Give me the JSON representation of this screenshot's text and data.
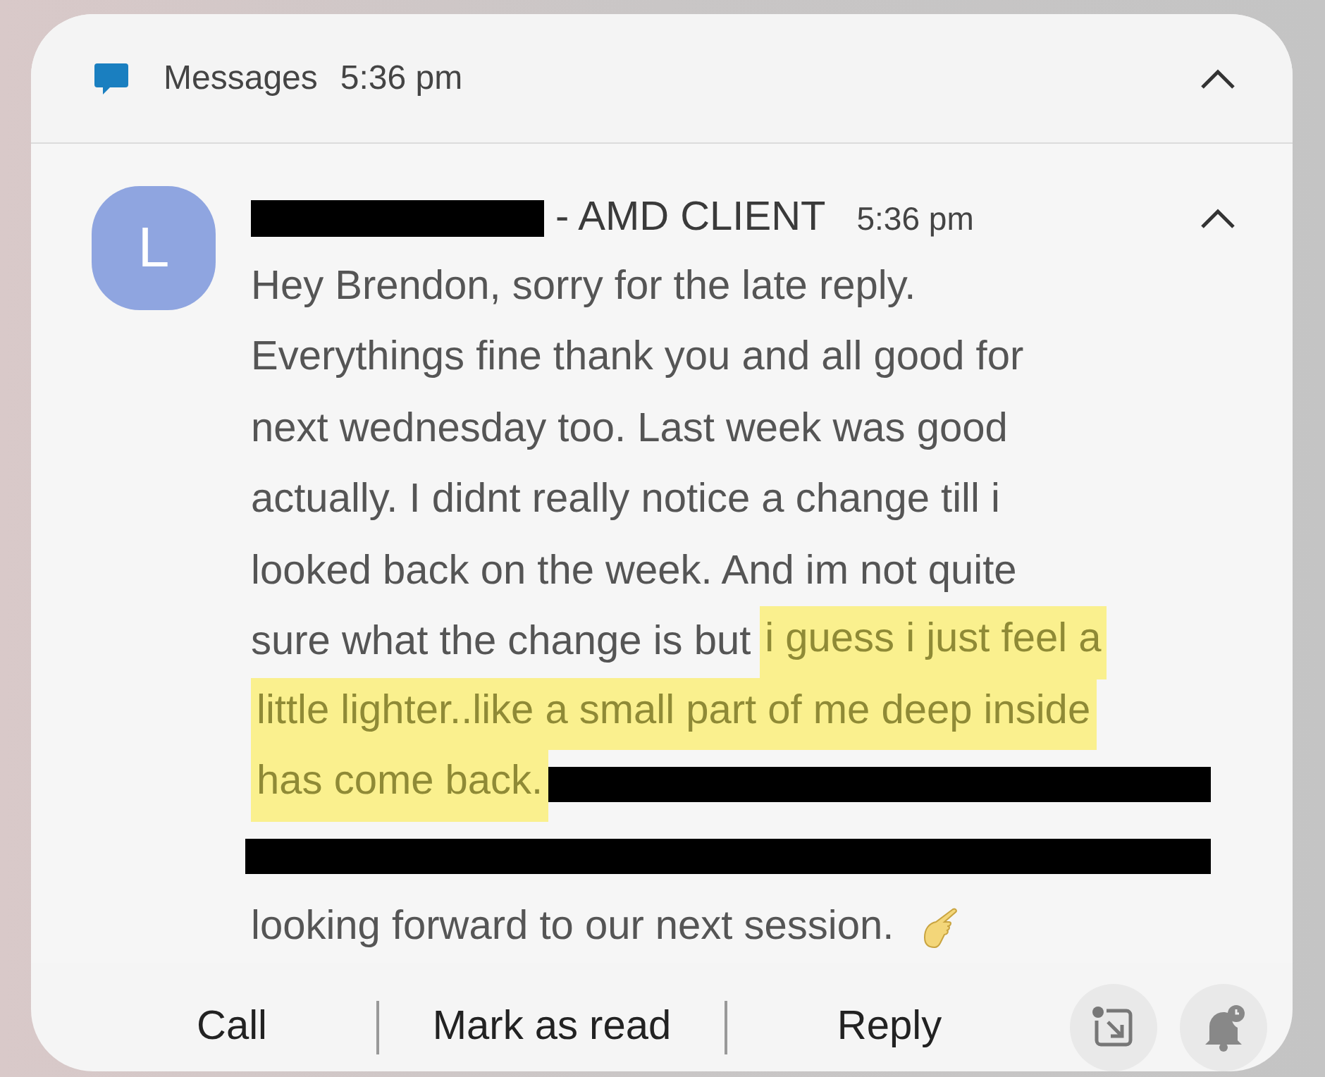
{
  "app_header": {
    "app_name": "Messages",
    "time": "5:36 pm"
  },
  "notification": {
    "avatar_letter": "L",
    "sender_suffix": "- AMD CLIENT",
    "time": "5:36 pm",
    "message_lines": [
      [
        {
          "kind": "text",
          "text": "Hey Brendon, sorry for the late reply."
        }
      ],
      [
        {
          "kind": "text",
          "text": "Everythings fine thank you and all good for"
        }
      ],
      [
        {
          "kind": "text",
          "text": "next wednesday too. Last week was good"
        }
      ],
      [
        {
          "kind": "text",
          "text": "actually. I didnt really notice a change till i"
        }
      ],
      [
        {
          "kind": "text",
          "text": "looked back on the week. And im not quite"
        }
      ],
      [
        {
          "kind": "text",
          "text": "sure what the change is but"
        },
        {
          "kind": "highlight",
          "text": "i guess i just feel a"
        }
      ],
      [
        {
          "kind": "highlight",
          "text": "little lighter..like a small part of me deep inside"
        }
      ],
      [
        {
          "kind": "highlight",
          "text": "has come back."
        },
        {
          "kind": "redaction"
        }
      ],
      [
        {
          "kind": "redaction"
        }
      ],
      [
        {
          "kind": "text",
          "text": "looking forward to our next session."
        },
        {
          "kind": "emoji"
        }
      ]
    ]
  },
  "actions": [
    "Call",
    "Mark as read",
    "Reply"
  ]
}
